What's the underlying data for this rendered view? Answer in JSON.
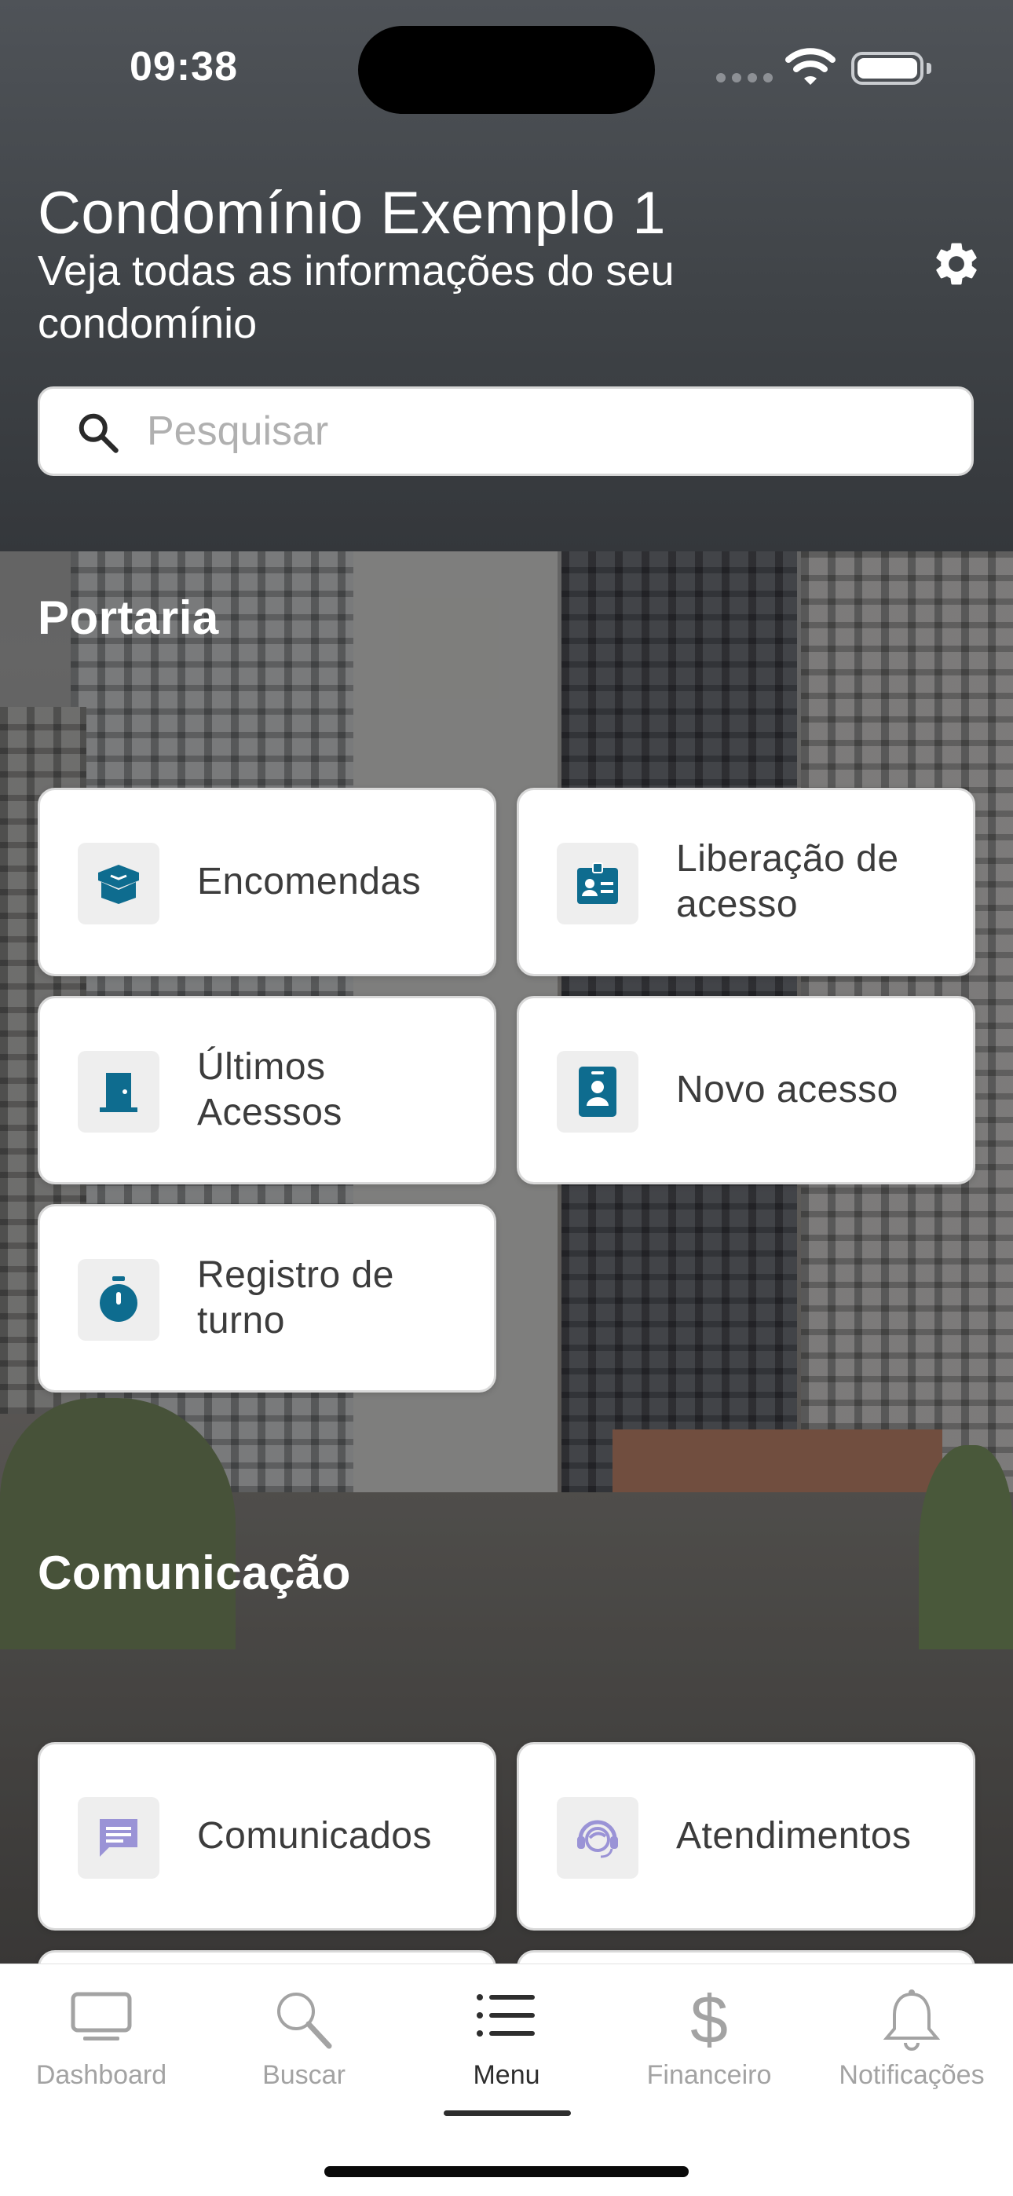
{
  "status_bar": {
    "time": "09:38"
  },
  "header": {
    "title": "Condomínio Exemplo 1",
    "subtitle": "Veja todas as informações do seu condomínio",
    "settings_icon": "gear-icon"
  },
  "search": {
    "placeholder": "Pesquisar",
    "value": ""
  },
  "sections": {
    "portaria": {
      "title": "Portaria",
      "items": [
        {
          "label": "Encomendas",
          "icon": "package-icon"
        },
        {
          "label": "Liberação de acesso",
          "icon": "id-badge-icon"
        },
        {
          "label": "Últimos Acessos",
          "icon": "door-icon"
        },
        {
          "label": "Novo acesso",
          "icon": "contact-card-icon"
        },
        {
          "label": "Registro de turno",
          "icon": "stopwatch-icon"
        }
      ]
    },
    "comunicacao": {
      "title": "Comunicação",
      "items": [
        {
          "label": "Comunicados",
          "icon": "message-icon"
        },
        {
          "label": "Atendimentos",
          "icon": "support-agent-icon"
        }
      ]
    }
  },
  "tabbar": {
    "active": "Menu",
    "tabs": [
      {
        "label": "Dashboard",
        "icon": "monitor-icon"
      },
      {
        "label": "Buscar",
        "icon": "search-icon"
      },
      {
        "label": "Menu",
        "icon": "list-icon"
      },
      {
        "label": "Financeiro",
        "icon": "dollar-icon"
      },
      {
        "label": "Notificações",
        "icon": "bell-icon"
      }
    ]
  },
  "colors": {
    "accent": "#0e6c8f",
    "accent_light": "#9a93d6",
    "header_bg": "#43474b",
    "active_tab": "#2e2e2e",
    "inactive_tab": "#a3a3a3"
  }
}
